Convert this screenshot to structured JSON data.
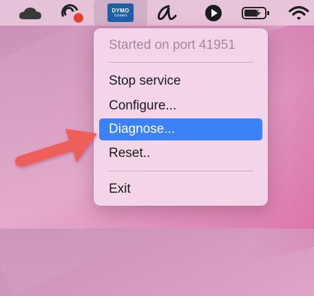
{
  "menubar": {
    "items": [
      {
        "icon": "cloud-icon"
      },
      {
        "icon": "sync-icon"
      },
      {
        "icon": "dymo-connect-icon",
        "line1": "DYMO",
        "line2": "Connect"
      },
      {
        "icon": "script-a-icon"
      },
      {
        "icon": "play-icon"
      },
      {
        "icon": "battery-charging-icon"
      },
      {
        "icon": "wifi-icon"
      }
    ]
  },
  "menu": {
    "status": "Started on port 41951",
    "items": [
      {
        "label": "Stop service"
      },
      {
        "label": "Configure..."
      },
      {
        "label": "Diagnose..."
      },
      {
        "label": "Reset.."
      },
      {
        "label": "Exit"
      }
    ],
    "highlight_color": "#3b82f6"
  },
  "annotation": {
    "arrow_color": "#ef5f5a"
  }
}
